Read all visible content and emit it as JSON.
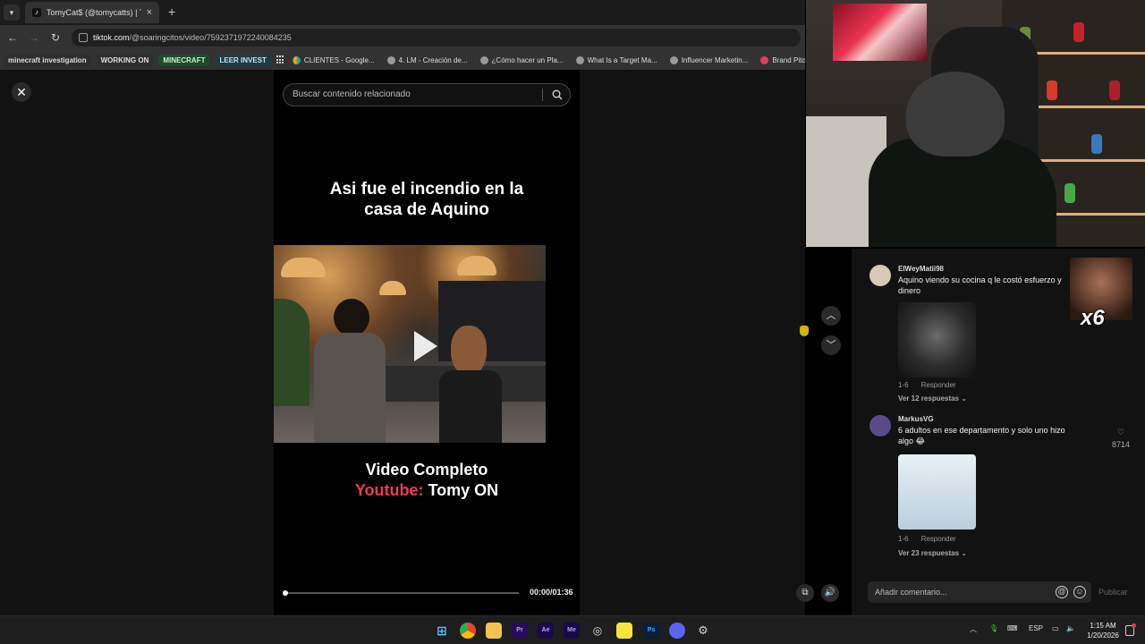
{
  "browser": {
    "tab_title": "TomyCat$ (@tomycatts) | TikTok",
    "url_host": "tiktok.com",
    "url_path": "/@soaringcitos/video/7592371972240084235",
    "bookmarks": [
      {
        "label": "minecraft investigation",
        "style": "dark"
      },
      {
        "label": "WORKING ON",
        "style": "dark"
      },
      {
        "label": "MINECRAFT",
        "style": "green"
      },
      {
        "label": "LEER INVEST",
        "style": "teal"
      },
      {
        "label": "CLIENTES - Google...",
        "icon": "google-drive-icon"
      },
      {
        "label": "4. LM - Creación de...",
        "icon": "globe-icon"
      },
      {
        "label": "¿Cómo hacer un Pla...",
        "icon": "globe-icon"
      },
      {
        "label": "What Is a Target Ma...",
        "icon": "globe-icon"
      },
      {
        "label": "Influencer Marketin...",
        "icon": "globe-icon"
      },
      {
        "label": "Brand Pitch Gui",
        "icon": "brand-icon"
      }
    ]
  },
  "tiktok": {
    "search_placeholder": "Buscar contenido relacionado",
    "overlay_top": "Asi fue el incendio en la casa de Aquino",
    "overlay_bottom_line1": "Video Completo",
    "overlay_bottom_yt": "Youtube:",
    "overlay_bottom_channel": "Tomy ON",
    "time": "00:00/01:36",
    "progress": 0.0
  },
  "comments": [
    {
      "user": "ElWeyMatii98",
      "text": "Aquino viendo su cocina q le costó esfuerzo y dinero",
      "meta_age": "1-6",
      "reply_label": "Responder",
      "replies": "Ver 12 respuestas"
    },
    {
      "user": "MarkusVG",
      "text": "6 adultos en ese departamento y solo uno hizo algo 😂",
      "meta_age": "1-6",
      "reply_label": "Responder",
      "replies": "Ver 23 respuestas",
      "likes": "8714"
    }
  ],
  "composer": {
    "placeholder": "Añadir comentario...",
    "publish": "Publicar"
  },
  "meme_overlay": "x6",
  "taskbar": {
    "lang": "ESP",
    "time": "1:15 AM",
    "date": "1/20/2026"
  }
}
